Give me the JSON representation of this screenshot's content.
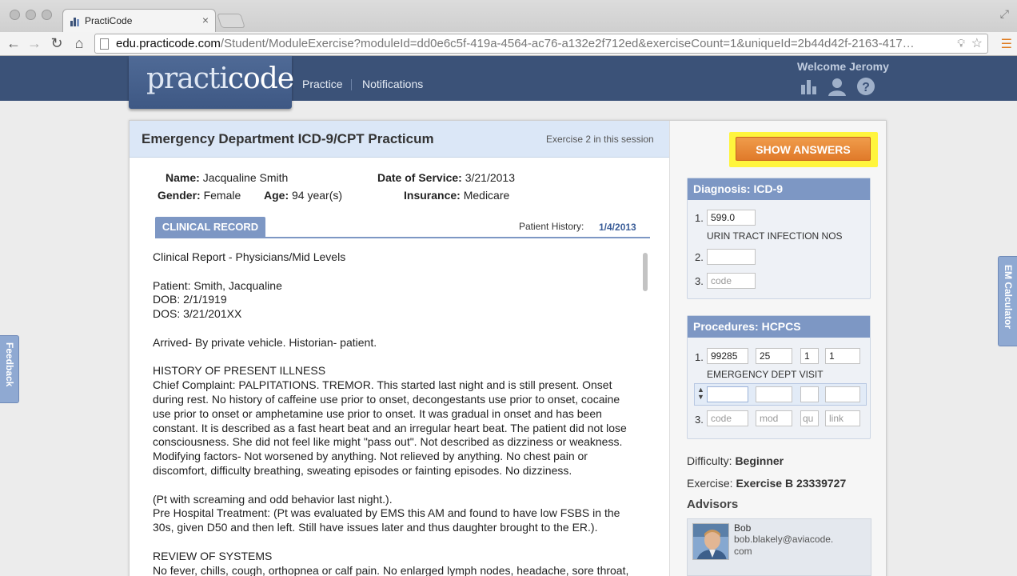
{
  "browser": {
    "tab_title": "PractiCode",
    "tab_close": "×",
    "url_domain": "edu.practicode.com",
    "url_path": "/Student/ModuleExercise?moduleId=dd0e6c5f-419a-4564-ac76-a132e2f712ed&exerciseCount=1&uniqueId=2b44d42f-2163-417…"
  },
  "site": {
    "logo_text_a": "practi",
    "logo_text_b": "code",
    "nav": {
      "practice": "Practice",
      "notifications": "Notifications"
    },
    "welcome": "Welcome Jeromy"
  },
  "exercise": {
    "title": "Emergency Department ICD-9/CPT Practicum",
    "count_label": "Exercise 2 in this session"
  },
  "patient": {
    "name_label": "Name:",
    "name": "Jacqualine Smith",
    "dos_label": "Date of Service:",
    "dos": "3/21/2013",
    "gender_label": "Gender:",
    "gender": "Female",
    "age_label": "Age:",
    "age": "94 year(s)",
    "insurance_label": "Insurance:",
    "insurance": "Medicare"
  },
  "clinical": {
    "tab_label": "CLINICAL RECORD",
    "history_label": "Patient History:",
    "history_date": "1/4/2013",
    "record_lines": [
      "Clinical Report - Physicians/Mid Levels",
      "",
      "Patient: Smith, Jacqualine",
      "DOB: 2/1/1919",
      "DOS: 3/21/201XX",
      "",
      "Arrived- By private vehicle. Historian- patient.",
      "",
      "HISTORY OF PRESENT ILLNESS",
      "Chief Complaint: PALPITATIONS. TREMOR. This started last night and is still present. Onset during rest. No history of caffeine use prior to onset, decongestants use prior to onset, cocaine use prior to onset or amphetamine use prior to onset. It was gradual in onset and has been constant. It is described as a fast heart beat and an irregular heart beat. The patient did not lose consciousness. She did not feel like might \"pass out\". Not described as dizziness or weakness. Modifying factors- Not worsened by anything. Not relieved by anything. No chest pain or discomfort, difficulty breathing, sweating episodes or fainting episodes. No dizziness.",
      "",
      "(Pt with screaming and odd behavior last night.).",
      "Pre Hospital Treatment: (Pt was evaluated by EMS this AM and found to have low FSBS in the 30s, given D50 and then left. Still have issues later and thus daughter brought to the ER.).",
      "",
      "REVIEW OF SYSTEMS",
      "No fever, chills, cough, orthopnea or calf pain. No enlarged lymph nodes, headache, sore throat,"
    ]
  },
  "right": {
    "show_answers": "SHOW ANSWERS",
    "diagnosis": {
      "header": "Diagnosis: ICD-9",
      "rows": [
        {
          "num": "1.",
          "code": "599.0",
          "desc": "URIN TRACT INFECTION NOS"
        },
        {
          "num": "2.",
          "code": ""
        },
        {
          "num": "3.",
          "placeholder": "code"
        }
      ]
    },
    "procedures": {
      "header": "Procedures: HCPCS",
      "row1": {
        "num": "1.",
        "code": "99285",
        "mod": "25",
        "qu": "1",
        "link": "1",
        "desc": "EMERGENCY DEPT VISIT"
      },
      "row2": {
        "code": "",
        "mod": "",
        "qu": "",
        "link": ""
      },
      "row3": {
        "num": "3.",
        "code_ph": "code",
        "mod_ph": "mod",
        "qu_ph": "qu",
        "link_ph": "link"
      }
    },
    "difficulty_label": "Difficulty:",
    "difficulty": "Beginner",
    "exercise_label": "Exercise:",
    "exercise": "Exercise B 23339727",
    "advisors_label": "Advisors",
    "advisor": {
      "name": "Bob",
      "email": "bob.blakely@aviacode.com"
    }
  },
  "side_tabs": {
    "feedback": "Feedback",
    "em_calculator": "EM Calculator"
  },
  "colors": {
    "header_navy": "#3b5278",
    "accent_blue": "#7d97c4",
    "show_answers_orange": "#e88a38",
    "highlight_yellow": "#fff53d"
  }
}
